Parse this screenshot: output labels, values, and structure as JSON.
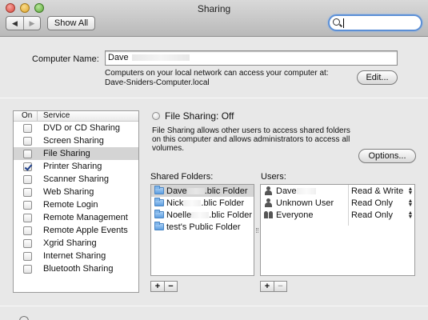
{
  "window": {
    "title": "Sharing"
  },
  "toolbar": {
    "back_glyph": "◀",
    "forward_glyph": "▶",
    "show_all_label": "Show All",
    "search_value": ""
  },
  "computer_name": {
    "label": "Computer Name:",
    "value": "Dave",
    "description": "Computers on your local network can access your computer at: Dave-Sniders-Computer.local",
    "edit_label": "Edit..."
  },
  "services": {
    "col_on": "On",
    "col_service": "Service",
    "items": [
      {
        "name": "DVD or CD Sharing",
        "on": false
      },
      {
        "name": "Screen Sharing",
        "on": false
      },
      {
        "name": "File Sharing",
        "on": false,
        "selected": true
      },
      {
        "name": "Printer Sharing",
        "on": true
      },
      {
        "name": "Scanner Sharing",
        "on": false
      },
      {
        "name": "Web Sharing",
        "on": false
      },
      {
        "name": "Remote Login",
        "on": false
      },
      {
        "name": "Remote Management",
        "on": false
      },
      {
        "name": "Remote Apple Events",
        "on": false
      },
      {
        "name": "Xgrid Sharing",
        "on": false
      },
      {
        "name": "Internet Sharing",
        "on": false
      },
      {
        "name": "Bluetooth Sharing",
        "on": false
      }
    ]
  },
  "file_sharing": {
    "status": "File Sharing: Off",
    "description": "File Sharing allows other users to access shared folders on this computer and allows administrators to access all volumes.",
    "options_label": "Options..."
  },
  "shared_folders": {
    "label": "Shared Folders:",
    "items": [
      {
        "prefix": "Dave",
        "suffix": ".blic Folder"
      },
      {
        "prefix": "Nick",
        "suffix": ".blic Folder"
      },
      {
        "prefix": "Noelle",
        "suffix": ".blic Folder"
      },
      {
        "prefix": "test's Public Folder",
        "suffix": ""
      }
    ]
  },
  "users": {
    "label": "Users:",
    "items": [
      {
        "name": "Dave",
        "permission": "Read & Write",
        "icon": "person-icon"
      },
      {
        "name": "Unknown User",
        "permission": "Read Only",
        "icon": "person-icon"
      },
      {
        "name": "Everyone",
        "permission": "Read Only",
        "icon": "group-icon"
      }
    ]
  },
  "buttons": {
    "add": "+",
    "remove": "−"
  }
}
